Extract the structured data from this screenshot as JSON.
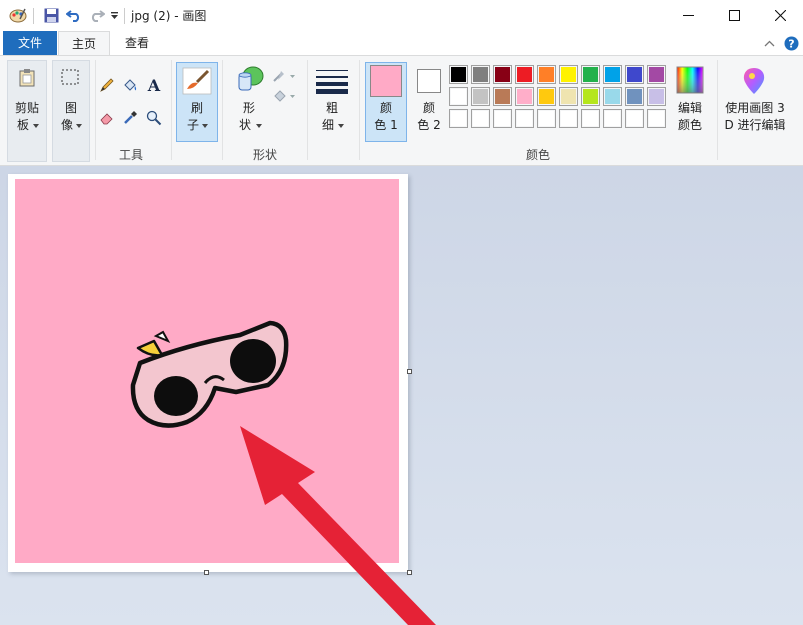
{
  "window": {
    "title": "jpg (2) - 画图"
  },
  "tabs": [
    {
      "label": "文件"
    },
    {
      "label": "主页"
    },
    {
      "label": "查看"
    }
  ],
  "groups": {
    "clipboard": {
      "label_line1": "剪贴",
      "label_line2": "板"
    },
    "image": {
      "label_line1": "图",
      "label_line2": "像"
    },
    "tools": {
      "label": "工具"
    },
    "brushes": {
      "label_line1": "刷",
      "label_line2": "子"
    },
    "shapes": {
      "label": "形状",
      "button_line1": "形",
      "button_line2": "状"
    },
    "size": {
      "label_line1": "粗",
      "label_line2": "细"
    },
    "colors": {
      "label": "颜色",
      "color1_line1": "颜",
      "color1_line2": "色 1",
      "color2_line1": "颜",
      "color2_line2": "色 2",
      "edit_line1": "编辑",
      "edit_line2": "颜色",
      "color1": "#ffaac6",
      "color2": "#ffffff",
      "palette_row1": [
        "#000000",
        "#7f7f7f",
        "#880015",
        "#ed1c24",
        "#ff7f27",
        "#fff200",
        "#22b14c",
        "#00a2e8",
        "#3f48cc",
        "#a349a4"
      ],
      "palette_row2": [
        "#ffffff",
        "#c3c3c3",
        "#b97a57",
        "#ffaec9",
        "#ffc90e",
        "#efe4b0",
        "#b5e61d",
        "#99d9ea",
        "#7092be",
        "#c8bfe7"
      ],
      "palette_row3": [
        "#ffffff",
        "#ffffff",
        "#ffffff",
        "#ffffff",
        "#ffffff",
        "#ffffff",
        "#ffffff",
        "#ffffff",
        "#ffffff",
        "#ffffff"
      ]
    },
    "paint3d": {
      "line1": "使用画图 3",
      "line2": "D 进行编辑"
    }
  },
  "canvas": {
    "background": "#ffaac6",
    "content": "sunglasses-sticker",
    "annotation": "red-arrow"
  }
}
